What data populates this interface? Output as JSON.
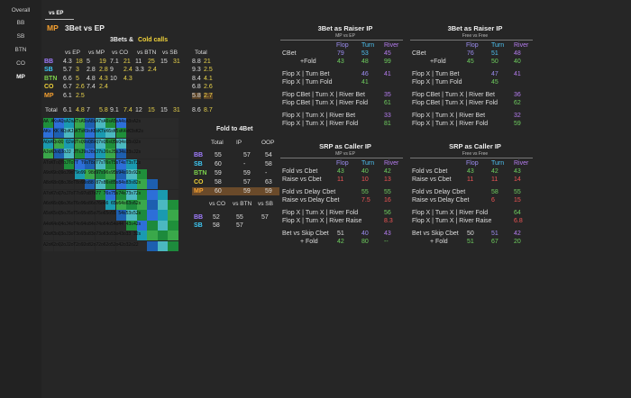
{
  "sidebar": {
    "items": [
      "Overall",
      "BB",
      "SB",
      "BTN",
      "CO",
      "MP"
    ],
    "selected": "MP"
  },
  "tab": {
    "label": "vs EP"
  },
  "title": {
    "pos": "MP",
    "text": "3Bet vs EP"
  },
  "threebets": {
    "header_a": "3Bets &",
    "header_b": "Cold calls",
    "cols": [
      "vs EP",
      "vs MP",
      "vs CO",
      "vs BTN",
      "vs SB",
      "Total"
    ],
    "rows": [
      {
        "pos": "BB",
        "v": [
          "4.3",
          "18",
          "5",
          "19",
          "7.1",
          "21",
          "11",
          "25",
          "15",
          "31",
          "8.8",
          "21"
        ]
      },
      {
        "pos": "SB",
        "v": [
          "5.7",
          "3",
          "2.8",
          "2.8",
          "9",
          "2.4",
          "3.3",
          "2.4",
          "",
          "",
          "9.3",
          "2.5"
        ]
      },
      {
        "pos": "BTN",
        "v": [
          "6.6",
          "5",
          "4.8",
          "4.3",
          "10",
          "4.3",
          "",
          "",
          "",
          "",
          "8.4",
          "4.1"
        ]
      },
      {
        "pos": "CO",
        "v": [
          "6.7",
          "2.6",
          "7.4",
          "2.4",
          "",
          "",
          "",
          "",
          "",
          "",
          "6.8",
          "2.6"
        ]
      },
      {
        "pos": "MP",
        "v": [
          "6.1",
          "2.5",
          "",
          "",
          "",
          "",
          "",
          "",
          "",
          "",
          "5.8",
          "2.7"
        ]
      }
    ],
    "total": {
      "label": "Total",
      "v": [
        "6.1",
        "4.8",
        "7",
        "5.8",
        "9.1",
        "7.4",
        "12",
        "15",
        "15",
        "31",
        "8.6",
        "8.7"
      ]
    }
  },
  "fold4bet": {
    "title": "Fold to 4Bet",
    "cols": [
      "Total",
      "IP",
      "OOP"
    ],
    "rows": [
      {
        "pos": "BB",
        "v": [
          "55",
          "57",
          "54"
        ]
      },
      {
        "pos": "SB",
        "v": [
          "60",
          "-",
          "58"
        ]
      },
      {
        "pos": "BTN",
        "v": [
          "59",
          "59",
          "-"
        ]
      },
      {
        "pos": "CO",
        "v": [
          "58",
          "57",
          "63"
        ]
      },
      {
        "pos": "MP",
        "v": [
          "60",
          "59",
          "59"
        ]
      }
    ],
    "cols2": [
      "vs CO",
      "vs BTN",
      "vs SB"
    ],
    "rows2": [
      {
        "pos": "BB",
        "v": [
          "52",
          "55",
          "57"
        ]
      },
      {
        "pos": "SB",
        "v": [
          "58",
          "57",
          ""
        ]
      }
    ]
  },
  "matrix": {
    "rows": [
      "AA AKsAQsAJsATsA9sA8sA7sA6sA5sA4sA3sA2s",
      "AKo KK KQsKJsKTsK9sK8sK7sK6sK5sK4sK3sK2s",
      "AQoKQoQQ QJsQTsQ9sQ8sQ7sQ6sQ5sQ4sQ3sQ2s",
      "AJoKJoQJoJJ JTsJ9sJ8sJ7sJ6sJ5sJ4sJ3sJ2s",
      "AToKToQToJToTT T9sT8sT7sT6sT5sT4sT3sT2s",
      "A9oK9oQ9oJ9oT9o99 98s97s96s95s94s93s92s",
      "A8oK8oQ8oJ8oT8o98o88 87s86s85s84s83s82s",
      "A7oK7oQ7oJ7oT7o97o87o77 76s75s74s73s72s",
      "A6oK6oQ6oJ6oT6o96o86o76o66 65s64s63s62s",
      "A5oK5oQ5oJ5oT5o95o85o75o65o55 54s53s52s",
      "A4oK4oQ4oJ4oT4o94o84o74o64o54o44 43s42s",
      "A3oK3oQ3oJ3oT3o93o83o73o63o53o43o33 32s",
      "A2oK2oQ2oJ2oT2o92o82o72o62o52o42o32o22"
    ]
  },
  "raiser_mp": {
    "title": "3Bet as Raiser IP",
    "subtitle": "MP vs EP",
    "cols": [
      "Flop",
      "Turn",
      "River"
    ],
    "lines": [
      {
        "label": "CBet",
        "v": [
          "79",
          "53",
          "45"
        ],
        "c": [
          "flop",
          "turn",
          "river"
        ]
      },
      {
        "label": "+Fold",
        "indent": true,
        "v": [
          "43",
          "48",
          "99"
        ],
        "c": [
          "g",
          "g",
          "g"
        ]
      },
      {
        "label": "Flop X | Turn Bet",
        "v": [
          "",
          "46",
          "41"
        ],
        "c": [
          "",
          "flop",
          "river"
        ]
      },
      {
        "label": "Flop X | Turn Fold",
        "v": [
          "",
          "41",
          ""
        ],
        "c": [
          "",
          "g",
          ""
        ]
      },
      {
        "label": "Flop CBet | Turn X | River Bet",
        "v": [
          "",
          "",
          "35"
        ],
        "c": [
          "",
          "",
          "river"
        ]
      },
      {
        "label": "Flop CBet | Turn X | River Fold",
        "v": [
          "",
          "",
          "61"
        ],
        "c": [
          "",
          "",
          "g"
        ]
      },
      {
        "label": "Flop X | Turn X | River Bet",
        "v": [
          "",
          "",
          "33"
        ],
        "c": [
          "",
          "",
          "river"
        ]
      },
      {
        "label": "Flop X | Turn X | River Fold",
        "v": [
          "",
          "",
          "81"
        ],
        "c": [
          "",
          "",
          "g"
        ]
      }
    ]
  },
  "raiser_ff": {
    "title": "3Bet as Raiser IP",
    "subtitle": "Free vs Free",
    "cols": [
      "Flop",
      "Turn",
      "River"
    ],
    "lines": [
      {
        "label": "CBet",
        "v": [
          "76",
          "51",
          "48"
        ],
        "c": [
          "flop",
          "turn",
          "river"
        ]
      },
      {
        "label": "+Fold",
        "indent": true,
        "v": [
          "45",
          "50",
          "40"
        ],
        "c": [
          "g",
          "g",
          "g"
        ]
      },
      {
        "label": "Flop X | Turn Bet",
        "v": [
          "",
          "47",
          "41"
        ],
        "c": [
          "",
          "flop",
          "river"
        ]
      },
      {
        "label": "Flop X | Turn Fold",
        "v": [
          "",
          "45",
          ""
        ],
        "c": [
          "",
          "g",
          ""
        ]
      },
      {
        "label": "Flop CBet | Turn X | River Bet",
        "v": [
          "",
          "",
          "36"
        ],
        "c": [
          "",
          "",
          "river"
        ]
      },
      {
        "label": "Flop CBet | Turn X | River Fold",
        "v": [
          "",
          "",
          "62"
        ],
        "c": [
          "",
          "",
          "g"
        ]
      },
      {
        "label": "Flop X | Turn X | River Bet",
        "v": [
          "",
          "",
          "32"
        ],
        "c": [
          "",
          "",
          "river"
        ]
      },
      {
        "label": "Flop X | Turn X | River Fold",
        "v": [
          "",
          "",
          "59"
        ],
        "c": [
          "",
          "",
          "g"
        ]
      }
    ]
  },
  "caller_mp": {
    "title": "SRP as Caller IP",
    "subtitle": "MP vs EP",
    "cols": [
      "Flop",
      "Turn",
      "River"
    ],
    "lines": [
      {
        "label": "Fold vs Cbet",
        "v": [
          "43",
          "40",
          "42"
        ],
        "c": [
          "g",
          "g",
          "g"
        ]
      },
      {
        "label": "Raise vs Cbet",
        "v": [
          "11",
          "10",
          "13"
        ],
        "c": [
          "r",
          "r",
          "r"
        ]
      },
      {
        "label": "Fold vs Delay Cbet",
        "v": [
          "",
          "55",
          "55"
        ],
        "c": [
          "",
          "g",
          "g"
        ]
      },
      {
        "label": "Raise vs Delay Cbet",
        "v": [
          "",
          "7.5",
          "16"
        ],
        "c": [
          "",
          "r",
          "r"
        ]
      },
      {
        "label": "Flop X | Turn X | River Fold",
        "v": [
          "",
          "",
          "56"
        ],
        "c": [
          "",
          "",
          "g"
        ]
      },
      {
        "label": "Flop X | Turn X | River Raise",
        "v": [
          "",
          "",
          "8.3"
        ],
        "c": [
          "",
          "",
          "r"
        ]
      },
      {
        "label": "Bet vs Skip Cbet",
        "v": [
          "51",
          "40",
          "43"
        ],
        "c": [
          "w",
          "flop",
          "river"
        ]
      },
      {
        "label": "+ Fold",
        "indent": true,
        "v": [
          "42",
          "80",
          "--"
        ],
        "c": [
          "g",
          "g",
          "g"
        ]
      }
    ]
  },
  "caller_ff": {
    "title": "SRP as Caller IP",
    "subtitle": "Free vs Free",
    "cols": [
      "Flop",
      "Turn",
      "River"
    ],
    "lines": [
      {
        "label": "Fold vs Cbet",
        "v": [
          "43",
          "42",
          "43"
        ],
        "c": [
          "g",
          "g",
          "g"
        ]
      },
      {
        "label": "Raise vs Cbet",
        "v": [
          "11",
          "11",
          "14"
        ],
        "c": [
          "r",
          "r",
          "r"
        ]
      },
      {
        "label": "Fold vs Delay Cbet",
        "v": [
          "",
          "58",
          "55"
        ],
        "c": [
          "",
          "g",
          "g"
        ]
      },
      {
        "label": "Raise vs Delay Cbet",
        "v": [
          "",
          "6",
          "15"
        ],
        "c": [
          "",
          "r",
          "r"
        ]
      },
      {
        "label": "Flop X | Turn X | River Fold",
        "v": [
          "",
          "",
          "64"
        ],
        "c": [
          "",
          "",
          "g"
        ]
      },
      {
        "label": "Flop X | Turn X | River Raise",
        "v": [
          "",
          "",
          "6.8"
        ],
        "c": [
          "",
          "",
          "r"
        ]
      },
      {
        "label": "Bet vs Skip Cbet",
        "v": [
          "50",
          "51",
          "42"
        ],
        "c": [
          "w",
          "flop",
          "river"
        ]
      },
      {
        "label": "+ Fold",
        "indent": true,
        "v": [
          "51",
          "67",
          "20"
        ],
        "c": [
          "g",
          "g",
          "g"
        ]
      }
    ]
  }
}
